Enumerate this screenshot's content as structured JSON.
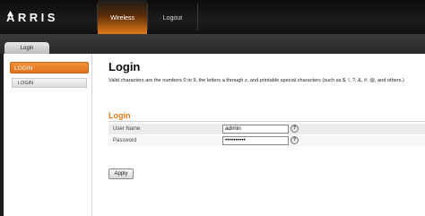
{
  "brand": {
    "logo_text": "ARRIS"
  },
  "nav": {
    "tabs": [
      {
        "label": "Wireless",
        "active": true
      },
      {
        "label": "Logout",
        "active": false
      }
    ]
  },
  "subnav": {
    "tab_label": "Login"
  },
  "sidebar": {
    "heading": "LOGIN",
    "items": [
      {
        "label": "LOGIN"
      }
    ]
  },
  "main": {
    "title": "Login",
    "description": "Valid characters are the numbers 0 to 9, the letters a through z, and printable special characters (such as $, !, ?, &, #, @, and others.)",
    "section_title": "Login",
    "fields": [
      {
        "label": "User Name",
        "value": "admin",
        "help": "?"
      },
      {
        "label": "Password",
        "value": "••••••••••",
        "help": "?"
      }
    ],
    "apply_label": "Apply"
  },
  "colors": {
    "accent": "#e07a1a",
    "header_bg": "#1a1a1a"
  },
  "icons": {
    "logo_mark": "arris-arrow-icon",
    "help": "help-icon"
  }
}
